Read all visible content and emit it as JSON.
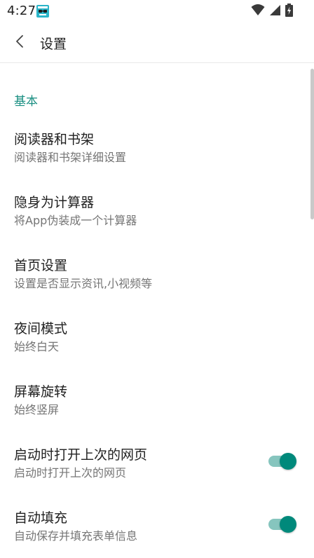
{
  "status_bar": {
    "time": "4:27",
    "app_icon": "notification-app-icon",
    "icons": [
      "wifi-icon",
      "cell-signal-icon",
      "battery-charging-icon"
    ]
  },
  "toolbar": {
    "back_icon": "chevron-left-icon",
    "title": "设置"
  },
  "sections": [
    {
      "header": "基本",
      "items": [
        {
          "title": "阅读器和书架",
          "summary": "阅读器和书架详细设置",
          "has_switch": false
        },
        {
          "title": "隐身为计算器",
          "summary": "将App伪装成一个计算器",
          "has_switch": false
        },
        {
          "title": "首页设置",
          "summary": "设置是否显示资讯,小视频等",
          "has_switch": false
        },
        {
          "title": "夜间模式",
          "summary": "始终白天",
          "has_switch": false
        },
        {
          "title": "屏幕旋转",
          "summary": "始终竖屏",
          "has_switch": false
        },
        {
          "title": "启动时打开上次的网页",
          "summary": "启动时打开上次的网页",
          "has_switch": true,
          "switch_on": true
        },
        {
          "title": "自动填充",
          "summary": "自动保存并填充表单信息",
          "has_switch": true,
          "switch_on": true
        }
      ]
    }
  ],
  "colors": {
    "accent": "#00897b",
    "accent_track": "#86c5be",
    "section_header": "#1a8f82",
    "title_text": "#212121",
    "summary_text": "#757575"
  }
}
